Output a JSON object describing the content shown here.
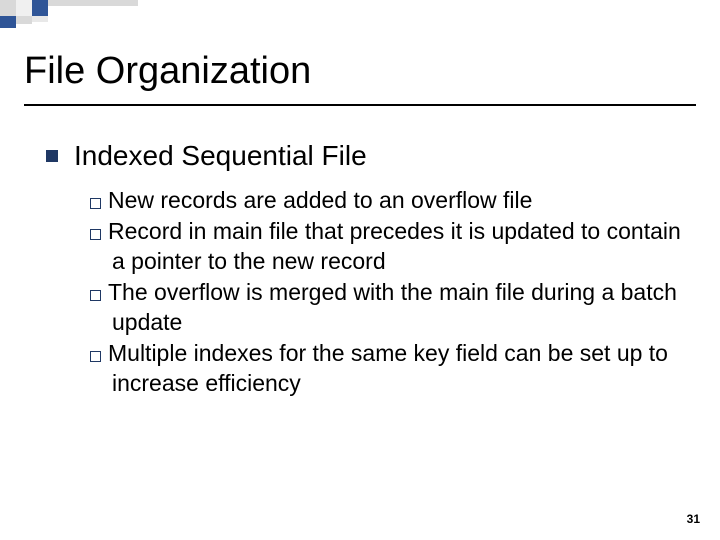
{
  "title": "File Organization",
  "heading": "Indexed Sequential File",
  "bullets": [
    "New records are added to an overflow file",
    "Record in main file that precedes it is updated to contain a pointer to the new record",
    "The overflow is merged with the main file during a batch update",
    "Multiple indexes for the same key field can be set up to increase efficiency"
  ],
  "page_number": "31"
}
